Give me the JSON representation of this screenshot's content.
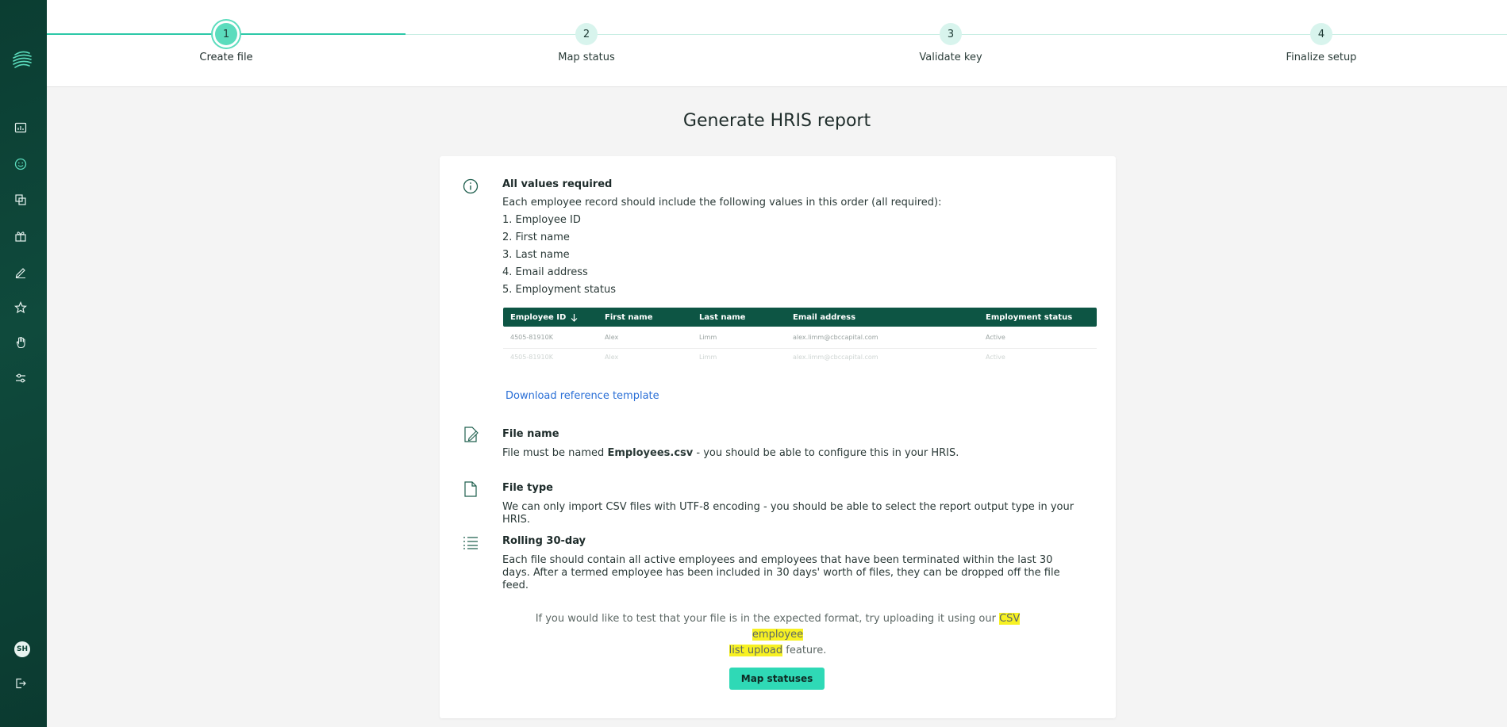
{
  "sidebar": {
    "avatar_initials": "SH",
    "icons": [
      "analytics-icon",
      "smiley-icon",
      "copy-icon",
      "gift-icon",
      "pen-icon",
      "star-icon",
      "hand-icon",
      "sliders-icon"
    ],
    "accent": "#2dc8a8"
  },
  "stepper": {
    "steps": [
      {
        "number": "1",
        "label": "Create file"
      },
      {
        "number": "2",
        "label": "Map status"
      },
      {
        "number": "3",
        "label": "Validate key"
      },
      {
        "number": "4",
        "label": "Finalize setup"
      }
    ],
    "active_step": 1
  },
  "page": {
    "title": "Generate HRIS report"
  },
  "values_section": {
    "heading": "All values required",
    "intro": "Each employee record should include the following values in this order (all required):",
    "items": [
      "1. Employee ID",
      "2. First name",
      "3. Last name",
      "4. Email address",
      "5. Employment status"
    ]
  },
  "reference_table": {
    "headers": [
      "Employee ID",
      "First name",
      "Last name",
      "Email address",
      "Employment status"
    ],
    "rows": [
      [
        "4505-81910K",
        "Alex",
        "Limm",
        "alex.limm@cbccapital.com",
        "Active"
      ],
      [
        "4505-81910K",
        "Alex",
        "Limm",
        "alex.limm@cbccapital.com",
        "Active"
      ]
    ]
  },
  "download_link": "Download reference template",
  "file_name_section": {
    "heading": "File name",
    "text_before": "File must be named ",
    "file_name": "Employees.csv",
    "text_after": " - you should be able to configure this in your HRIS."
  },
  "file_type_section": {
    "heading": "File type",
    "text": "We can only import CSV files with UTF-8 encoding - you should be able to select the report output type in your HRIS."
  },
  "rolling_section": {
    "heading": "Rolling 30-day",
    "text": "Each file should contain all active employees and employees that have been terminated within the last 30 days. After a termed employee has been included in 30 days' worth of files, they can be dropped off the file feed."
  },
  "note": {
    "text_before": "If you would like to test that your file is in the expected format, try uploading it using our ",
    "highlight_1": "CSV employee",
    "highlight_2": "list upload",
    "text_after": " feature."
  },
  "primary_button": "Map statuses"
}
